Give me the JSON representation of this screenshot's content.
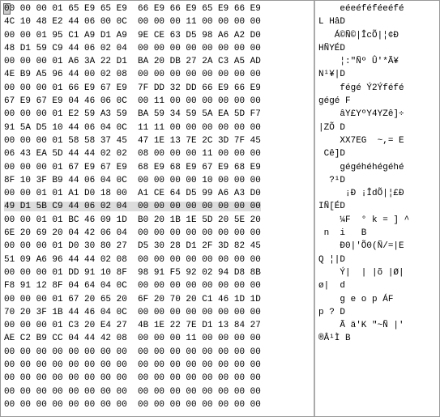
{
  "hex_rows": [
    "00 00 00 01 65 E9 65 E9  66 E9 66 E9 65 E9 66 E9",
    "4C 10 48 E2 44 06 00 0C  00 00 00 11 00 00 00 00",
    "00 00 01 95 C1 A9 D1 A9  9E CE 63 D5 98 A6 A2 D0",
    "48 D1 59 C9 44 06 02 04  00 00 00 00 00 00 00 00",
    "00 00 00 01 A6 3A 22 D1  BA 20 DB 27 2A C3 A5 AD",
    "4E B9 A5 96 44 00 02 08  00 00 00 00 00 00 00 00",
    "00 00 00 01 66 E9 67 E9  7F DD 32 DD 66 E9 66 E9",
    "67 E9 67 E9 04 46 06 0C  00 11 00 00 00 00 00 00",
    "00 00 00 01 E2 59 A3 59  BA 59 34 59 5A EA 5D F7",
    "91 5A D5 10 44 06 04 0C  11 11 00 00 00 00 00 00",
    "00 00 00 01 58 58 37 45  47 1E 13 7E 2C 3D 7F 45",
    "06 43 EA 5D 44 44 02 02  08 00 00 00 11 00 00 00",
    "00 00 00 01 67 E9 67 E9  68 E9 68 E9 67 E9 68 E9",
    "8F 10 3F B9 44 06 04 0C  00 00 00 00 10 00 00 00",
    "00 00 01 01 A1 D0 18 00  A1 CE 64 D5 99 A6 A3 D0",
    "49 D1 5B C9 44 06 02 04  00 00 00 00 00 00 00 00",
    "00 00 01 01 BC 46 09 1D  B0 20 1B 1E 5D 20 5E 20",
    "6E 20 69 20 04 42 06 04  00 00 00 00 00 00 00 00",
    "00 00 00 01 D0 30 80 27  D5 30 28 D1 2F 3D 82 45",
    "51 09 A6 96 44 44 02 08  00 00 00 00 00 00 00 00",
    "00 00 00 01 DD 91 10 8F  98 91 F5 92 02 94 D8 8B",
    "F8 91 12 8F 04 64 04 0C  00 00 00 00 00 00 00 00",
    "00 00 00 01 67 20 65 20  6F 20 70 20 C1 46 1D 1D",
    "70 20 3F 1B 44 46 04 0C  00 00 00 00 00 00 00 00",
    "00 00 00 01 C3 20 E4 27  4B 1E 22 7E D1 13 84 27",
    "AE C2 B9 CC 04 44 42 08  00 00 00 11 00 00 00 00",
    "00 00 00 00 00 00 00 00  00 00 00 00 00 00 00 00",
    "00 00 00 00 00 00 00 00  00 00 00 00 00 00 00 00",
    "00 00 00 00 00 00 00 00  00 00 00 00 00 00 00 00",
    "00 00 00 00 00 00 00 00  00 00 00 00 00 00 00 00",
    "00 00 00 00 00 00 00 00  00 00 00 00 00 00 00 00"
  ],
  "ascii_rows": [
    "    eéeéféféeéfé",
    "L HâD           ",
    "   Á©Ñ©|ÎcÕ|¦¢Ð",
    "HÑYÉD           ",
    "    ¦:\"Ñº Û'*Ã¥­",
    "N¹¥|D           ",
    "    fégé Ý2Ýféfé",
    "gégé F          ",
    "    âY£YºY4YZê]÷",
    "|ZÕ D           ",
    "    XX7EG  ~,= E",
    " Cê]D           ",
    "    gégéhéhégéhé",
    "  ?¹D           ",
    "     ¡Ð ¡ÎdÕ|¦£Ð",
    "IÑ[ÉD           ",
    "    ¼F  ° k = ] ^",
    " n  i   B       ",
    "    Ð0|'Õ0(Ñ/=|E",
    "Q ¦|D           ",
    "    Ý|  | |õ |Ø|",
    "ø|  d           ",
    "    g e o p ÁF  ",
    "p ? D           ",
    "    Ã ä'K \"~Ñ |'",
    "®Â¹Ì B          ",
    "                ",
    "                ",
    "                ",
    "                ",
    "                "
  ],
  "cursor_position": {
    "row": 0,
    "col": 0
  },
  "selected_row": 15
}
